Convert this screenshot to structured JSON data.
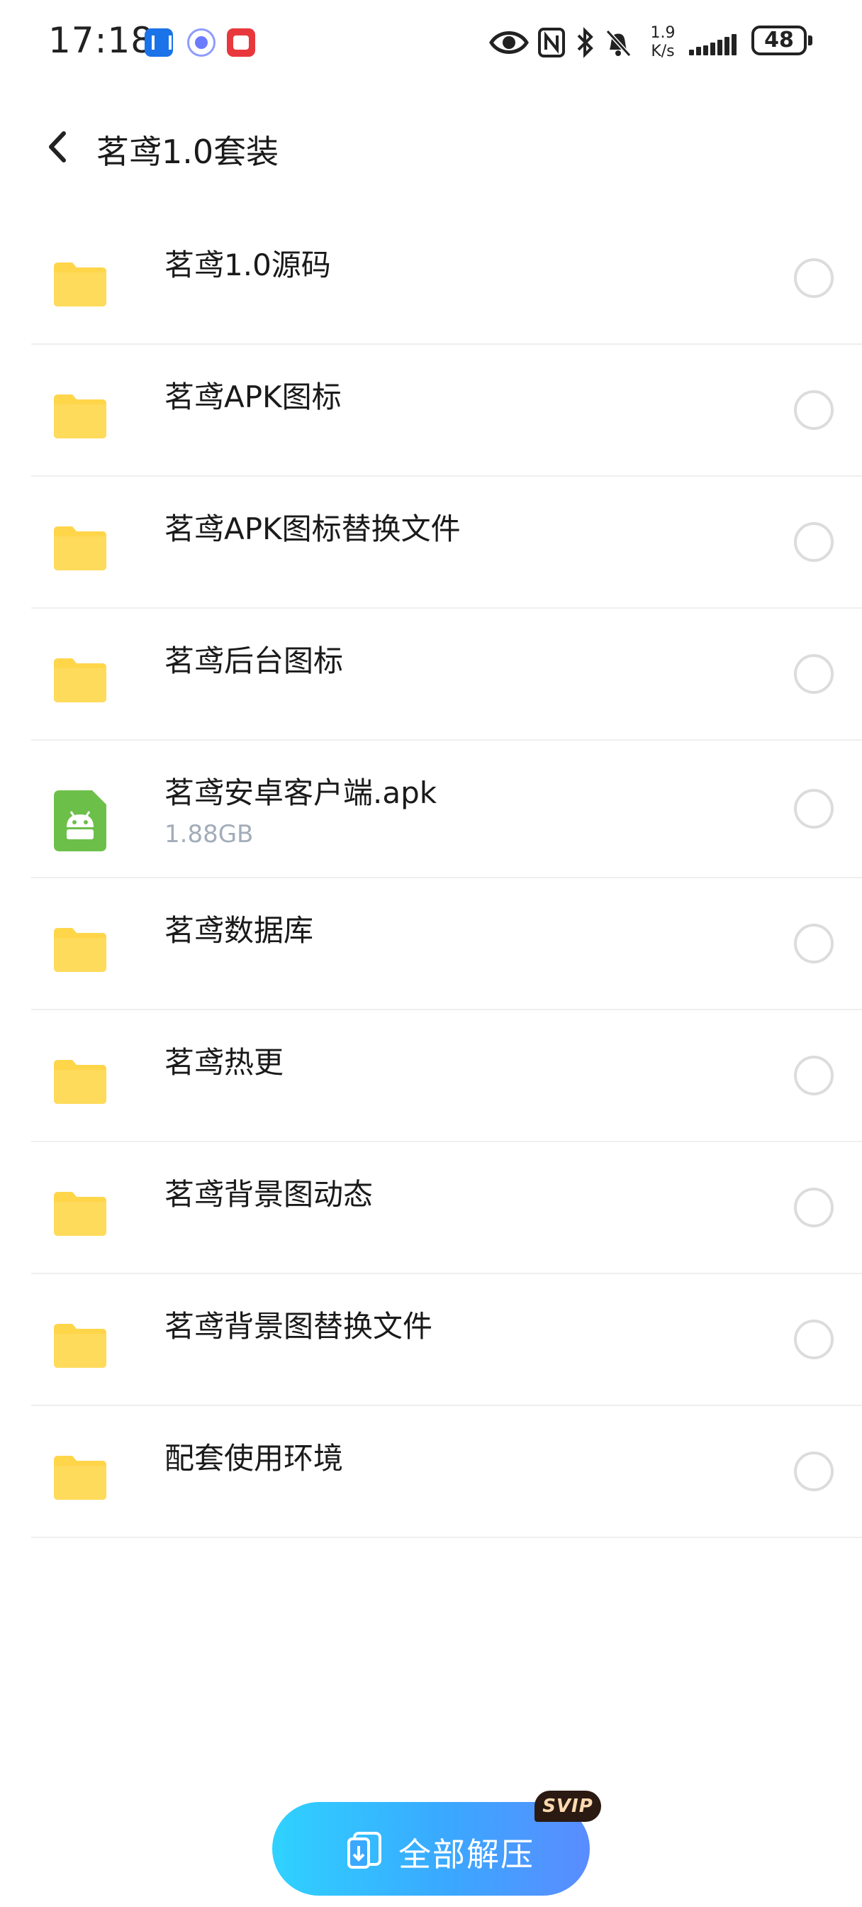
{
  "status_bar": {
    "time": "17:18",
    "net_speed_value": "1.9",
    "net_speed_unit": "K/s",
    "battery": "48",
    "icons": [
      "eye-icon",
      "nfc-icon",
      "bluetooth-icon",
      "mute-icon",
      "signal-icon",
      "battery-icon"
    ]
  },
  "header": {
    "back_icon": "chevron-left-icon",
    "title": "茗鸢1.0套装"
  },
  "files": [
    {
      "name": "茗鸢1.0源码",
      "type": "folder",
      "size": ""
    },
    {
      "name": "茗鸢APK图标",
      "type": "folder",
      "size": ""
    },
    {
      "name": "茗鸢APK图标替换文件",
      "type": "folder",
      "size": ""
    },
    {
      "name": "茗鸢后台图标",
      "type": "folder",
      "size": ""
    },
    {
      "name": "茗鸢安卓客户端.apk",
      "type": "apk",
      "size": "1.88GB"
    },
    {
      "name": "茗鸢数据库",
      "type": "folder",
      "size": ""
    },
    {
      "name": "茗鸢热更",
      "type": "folder",
      "size": ""
    },
    {
      "name": "茗鸢背景图动态",
      "type": "folder",
      "size": ""
    },
    {
      "name": "茗鸢背景图替换文件",
      "type": "folder",
      "size": ""
    },
    {
      "name": "配套使用环境",
      "type": "folder",
      "size": ""
    }
  ],
  "bottom": {
    "extract_all_label": "全部解压",
    "svip_badge": "SVIP"
  },
  "colors": {
    "folder": "#ffd54a",
    "apk": "#6cc04a",
    "accent": "#3aa8ff"
  }
}
